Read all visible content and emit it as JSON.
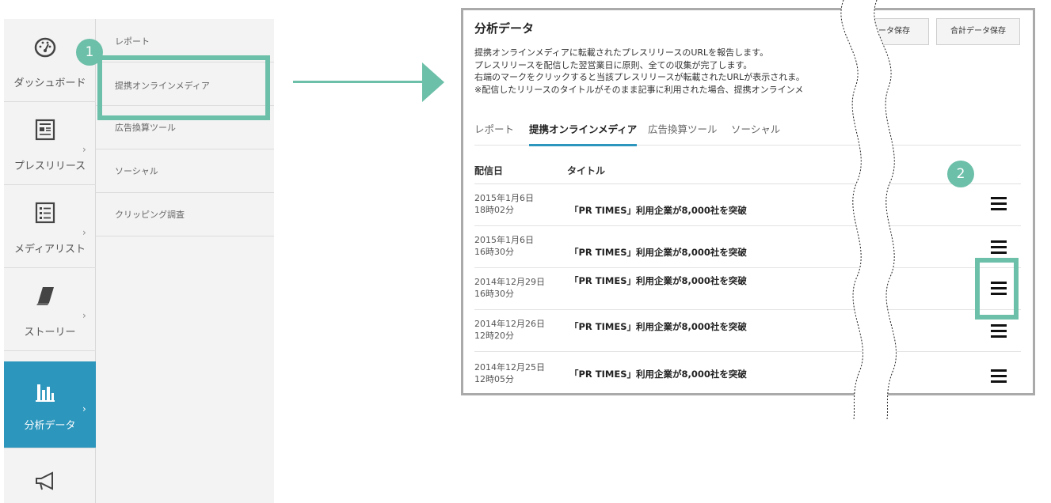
{
  "sidebar": {
    "items": [
      {
        "label": "ダッシュボード",
        "icon": "dashboard-gauge-icon"
      },
      {
        "label": "プレスリリース",
        "icon": "newspaper-icon"
      },
      {
        "label": "メディアリスト",
        "icon": "list-icon"
      },
      {
        "label": "ストーリー",
        "icon": "book-icon"
      },
      {
        "label": "分析データ",
        "icon": "bar-chart-icon"
      },
      {
        "label": "",
        "icon": "megaphone-icon"
      }
    ],
    "active_index": 4
  },
  "submenu": {
    "items": [
      "レポート",
      "提携オンラインメディア",
      "広告換算ツール",
      "ソーシャル",
      "クリッピング調査"
    ],
    "highlighted_index": 1
  },
  "markers": {
    "one": "1",
    "two": "2"
  },
  "panel": {
    "title": "分析データ",
    "save_buttons": [
      "ータ保存",
      "合計データ保存"
    ],
    "description": [
      "提携オンラインメディアに転載されたプレスリリースのURLを報告します。",
      "プレスリリースを配信した翌営業日に原則、全ての収集が完了します。",
      "右端のマークをクリックすると当該プレスリリースが転載されたURLが表示されま。",
      "※配信したリリースのタイトルがそのまま記事に利用された場合、提携オンラインメ"
    ],
    "tabs": [
      "レポート",
      "提携オンラインメディア",
      "広告換算ツール",
      "ソーシャル"
    ],
    "active_tab": 1,
    "table": {
      "headers": [
        "配信日",
        "タイトル"
      ],
      "rows": [
        {
          "date": "2015年1月6日",
          "time": "18時02分",
          "title": "「PR TIMES」利用企業が8,000社を突破"
        },
        {
          "date": "2015年1月6日",
          "time": "16時30分",
          "title": "「PR TIMES」利用企業が8,000社を突破"
        },
        {
          "date": "2014年12月29日",
          "time": "16時30分",
          "title": "「PR TIMES」利用企業が8,000社を突破"
        },
        {
          "date": "2014年12月26日",
          "time": "12時20分",
          "title": "「PR TIMES」利用企業が8,000社を突破"
        },
        {
          "date": "2014年12月25日",
          "time": "12時05分",
          "title": "「PR TIMES」利用企業が8,000社を突破"
        }
      ]
    },
    "row_menu_icon": "hamburger-menu-icon"
  },
  "colors": {
    "accent_teal": "#6cbfa8",
    "active_blue": "#2d96bd"
  }
}
